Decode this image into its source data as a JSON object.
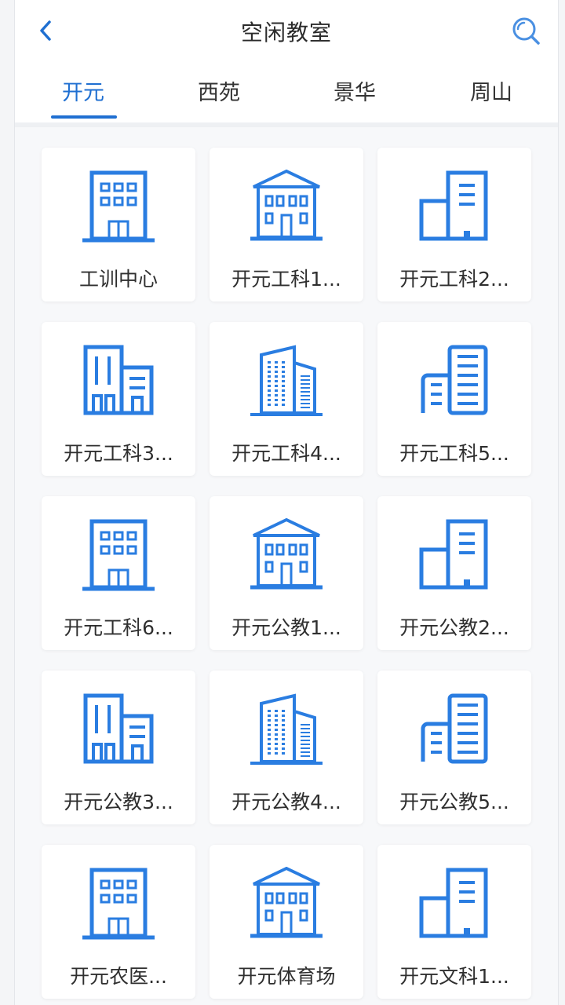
{
  "header": {
    "title": "空闲教室"
  },
  "tabs": [
    {
      "label": "开元",
      "active": true
    },
    {
      "label": "西苑",
      "active": false
    },
    {
      "label": "景华",
      "active": false
    },
    {
      "label": "周山",
      "active": false
    }
  ],
  "buildings": [
    {
      "label": "工训中心",
      "icon": "office-building-icon"
    },
    {
      "label": "开元工科1...",
      "icon": "classical-building-icon"
    },
    {
      "label": "开元工科2...",
      "icon": "tower-building-icon"
    },
    {
      "label": "开元工科3...",
      "icon": "apartment-building-icon"
    },
    {
      "label": "开元工科4...",
      "icon": "skyscraper-building-icon"
    },
    {
      "label": "开元工科5...",
      "icon": "striped-tower-building-icon"
    },
    {
      "label": "开元工科6...",
      "icon": "office-building-icon"
    },
    {
      "label": "开元公教1...",
      "icon": "classical-building-icon"
    },
    {
      "label": "开元公教2...",
      "icon": "tower-building-icon"
    },
    {
      "label": "开元公教3...",
      "icon": "apartment-building-icon"
    },
    {
      "label": "开元公教4...",
      "icon": "skyscraper-building-icon"
    },
    {
      "label": "开元公教5...",
      "icon": "striped-tower-building-icon"
    },
    {
      "label": "开元农医...",
      "icon": "office-building-icon"
    },
    {
      "label": "开元体育场",
      "icon": "classical-building-icon"
    },
    {
      "label": "开元文科1...",
      "icon": "tower-building-icon"
    }
  ],
  "colors": {
    "accent": "#1f6fd1",
    "icon": "#2a7de1"
  }
}
